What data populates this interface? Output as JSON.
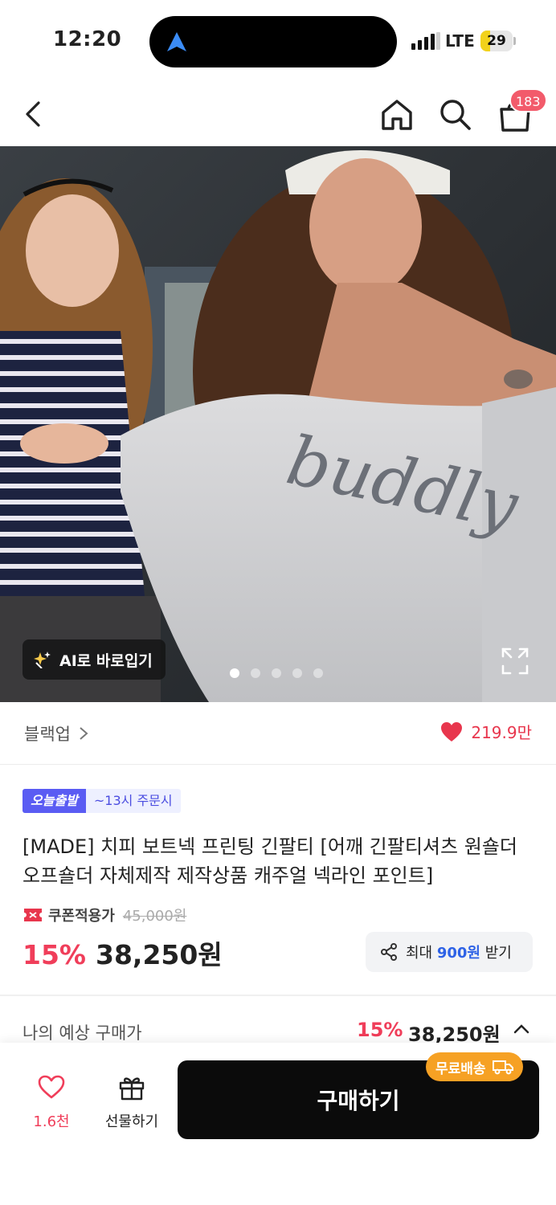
{
  "status_bar": {
    "time": "12:20",
    "network": "LTE",
    "battery": "29",
    "battery_level": 0.29,
    "icons": [
      "navigation-arrow-icon",
      "signal-icon",
      "battery-icon"
    ]
  },
  "top_nav": {
    "icons": [
      "back-icon",
      "home-icon",
      "search-icon",
      "cart-icon"
    ],
    "cart_count": "183"
  },
  "gallery": {
    "ai_button_label": "AI로 바로입기",
    "total_images": 5,
    "current_index": 1,
    "icons": [
      "sparkle-icon",
      "expand-icon"
    ],
    "print_text": "buddly"
  },
  "brand_row": {
    "brand_name": "블랙업",
    "likes": "219.9만",
    "heart_color": "#e8364d"
  },
  "product": {
    "badge_today": "오늘출발",
    "badge_order_deadline": "~13시 주문시",
    "title": "[MADE] 치피 보트넥 프린팅 긴팔티 [어깨 긴팔티셔츠 원숄더 오프숄더 자체제작 제작상품 캐주얼 넥라인 포인트]",
    "coupon_label": "쿠폰적용가",
    "original_price": "45,000원",
    "discount_rate": "15%",
    "sale_price": "38,250원",
    "point_prefix": "최대",
    "point_amount": "900원",
    "point_suffix": "받기",
    "accent_color": "#f03e5a"
  },
  "expected_price": {
    "label": "나의 예상 구매가",
    "discount_rate": "15%",
    "price": "38,250원"
  },
  "bottom_bar": {
    "wish_count": "1.6천",
    "gift_label": "선물하기",
    "buy_label": "구매하기",
    "free_shipping_label": "무료배송",
    "shipping_badge_color": "#f6a124"
  }
}
